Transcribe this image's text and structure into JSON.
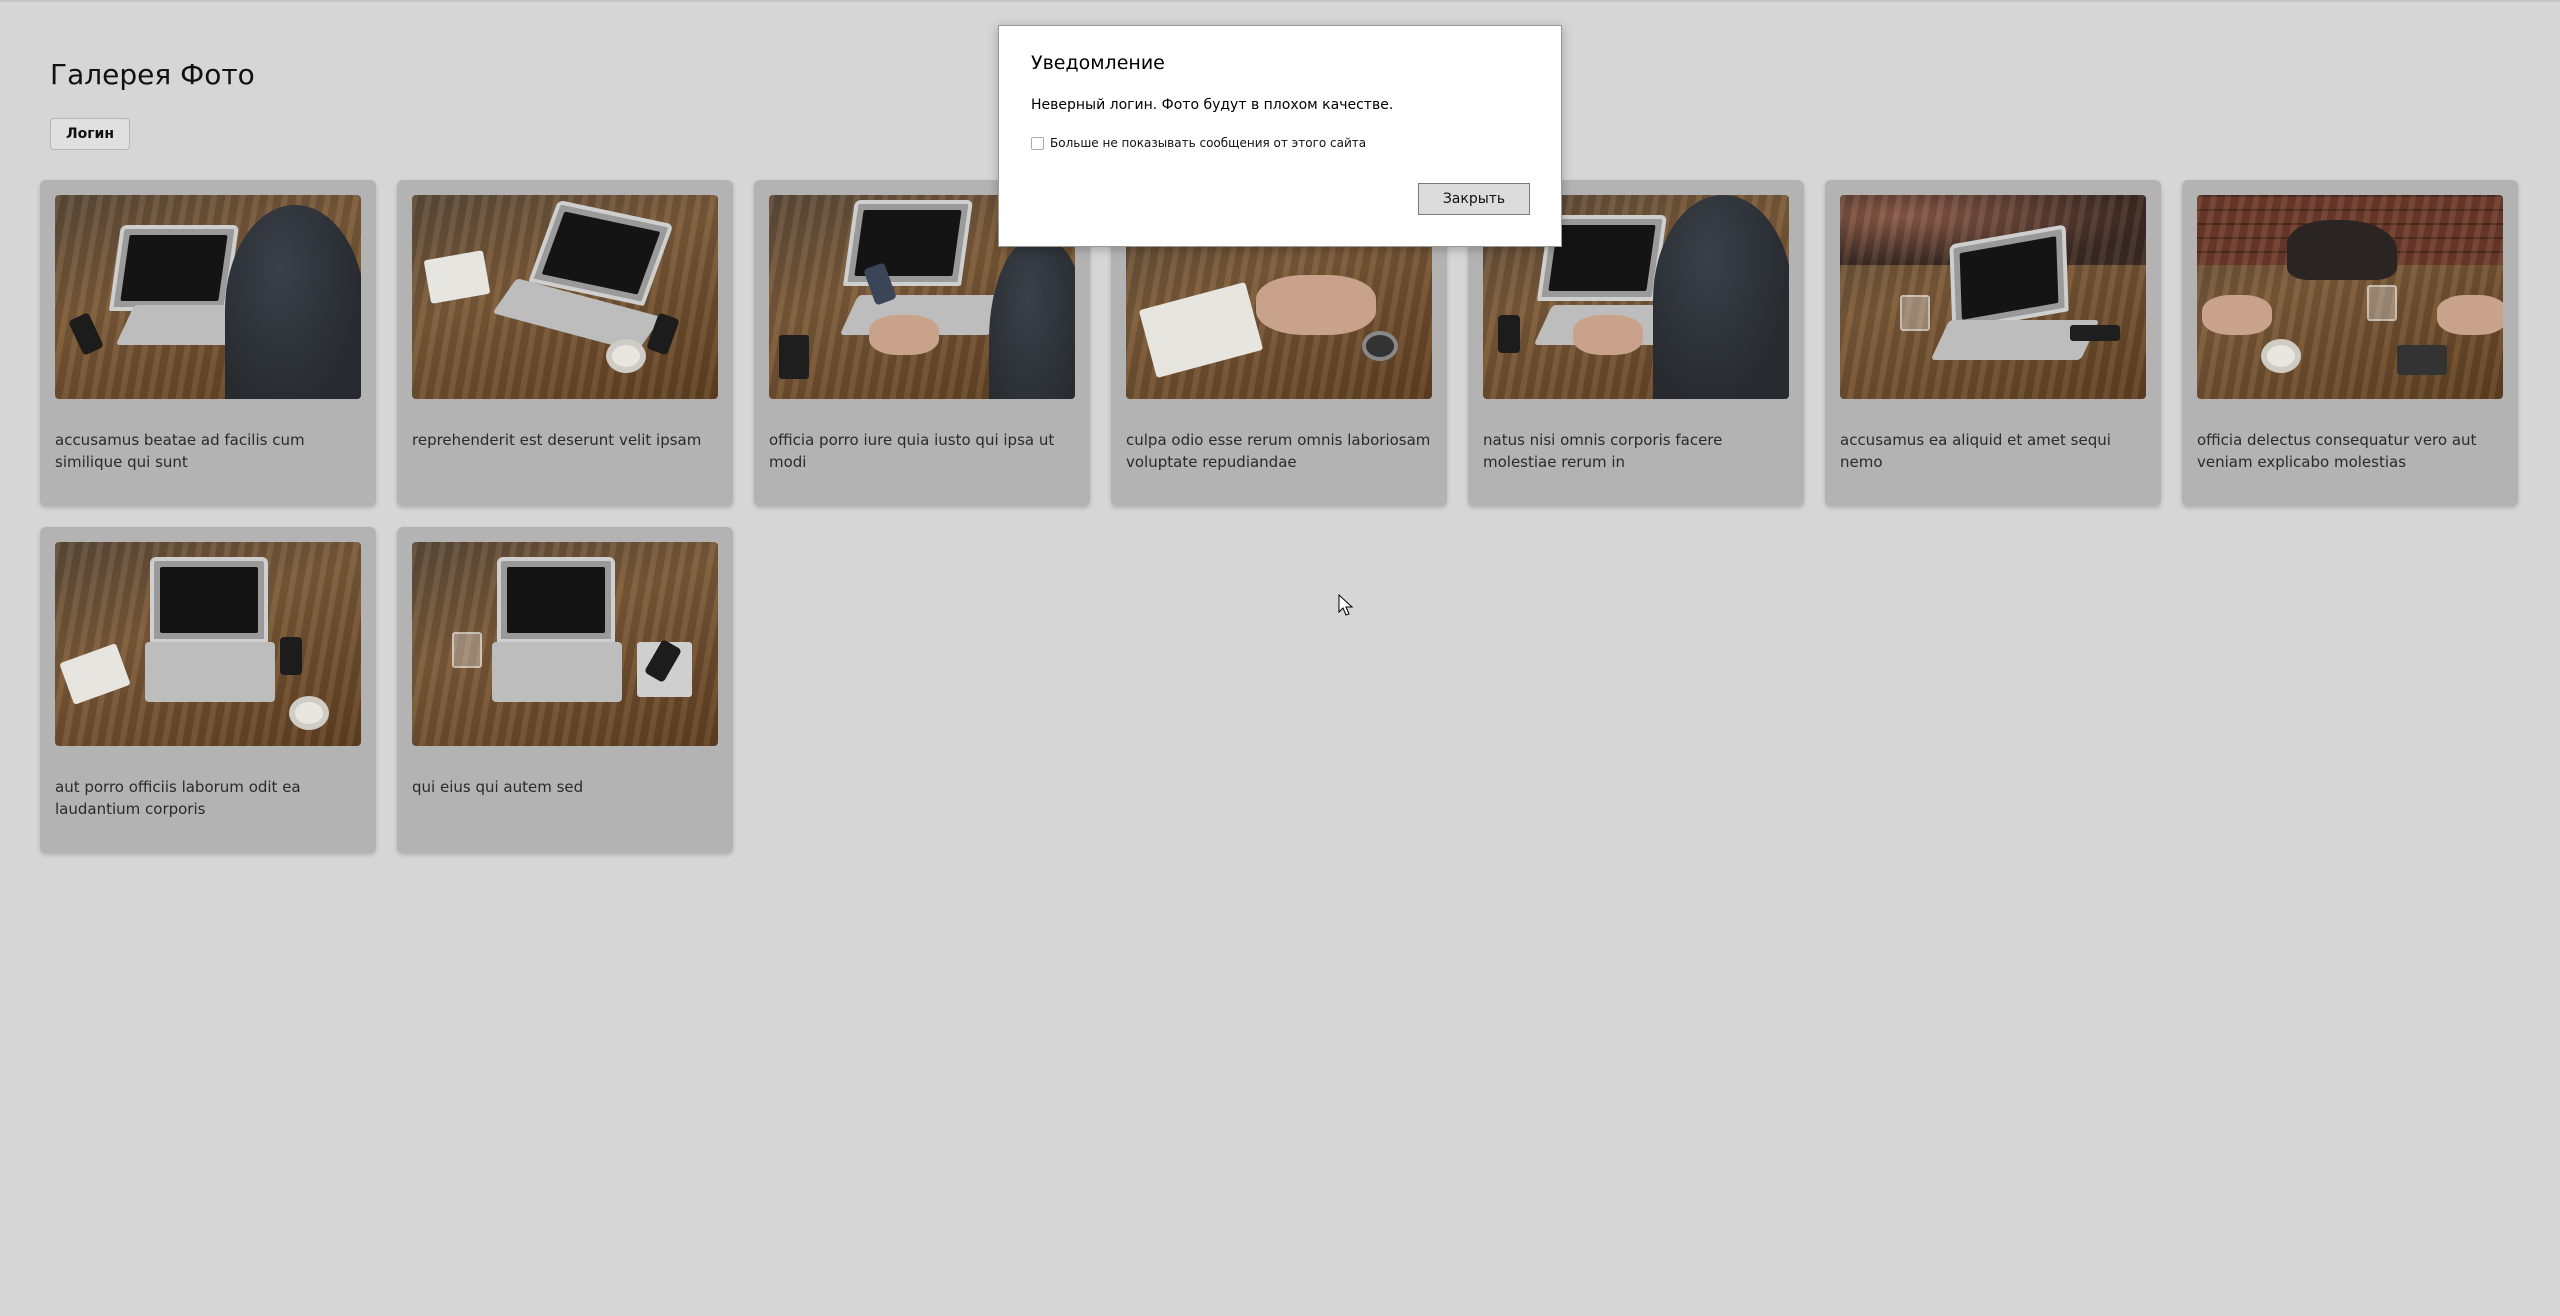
{
  "page": {
    "title": "Галерея Фото",
    "login_label": "Логин"
  },
  "gallery": {
    "cards": [
      {
        "caption": "accusamus beatae ad facilis cum similique qui sunt",
        "image": "photo-laptop-hands"
      },
      {
        "caption": "reprehenderit est deserunt velit ipsam",
        "image": "photo-laptop-coffee"
      },
      {
        "caption": "officia porro iure quia iusto qui ipsa ut modi",
        "image": "photo-laptop-phone"
      },
      {
        "caption": "culpa odio esse rerum omnis laboriosam voluptate repudiandae",
        "image": "photo-notebook-watch"
      },
      {
        "caption": "natus nisi omnis corporis facere molestiae rerum in",
        "image": "photo-laptop-typing"
      },
      {
        "caption": "accusamus ea aliquid et amet sequi nemo",
        "image": "photo-laptop-brick-wall"
      },
      {
        "caption": "officia delectus consequatur vero aut veniam explicabo molestias",
        "image": "photo-bag-table"
      },
      {
        "caption": "aut porro officiis laborum odit ea laudantium corporis",
        "image": "photo-laptop-top-view"
      },
      {
        "caption": "qui eius qui autem sed",
        "image": "photo-laptop-glass"
      }
    ]
  },
  "dialog": {
    "title": "Уведомление",
    "message": "Неверный логин. Фото будут в плохом качестве.",
    "checkbox_label": "Больше не показывать сообщения от этого сайта",
    "checkbox_checked": false,
    "close_label": "Закрыть"
  },
  "colors": {
    "page_background": "#d6d6d6",
    "card_background": "#b3b3b3",
    "dialog_background": "#ffffff"
  }
}
